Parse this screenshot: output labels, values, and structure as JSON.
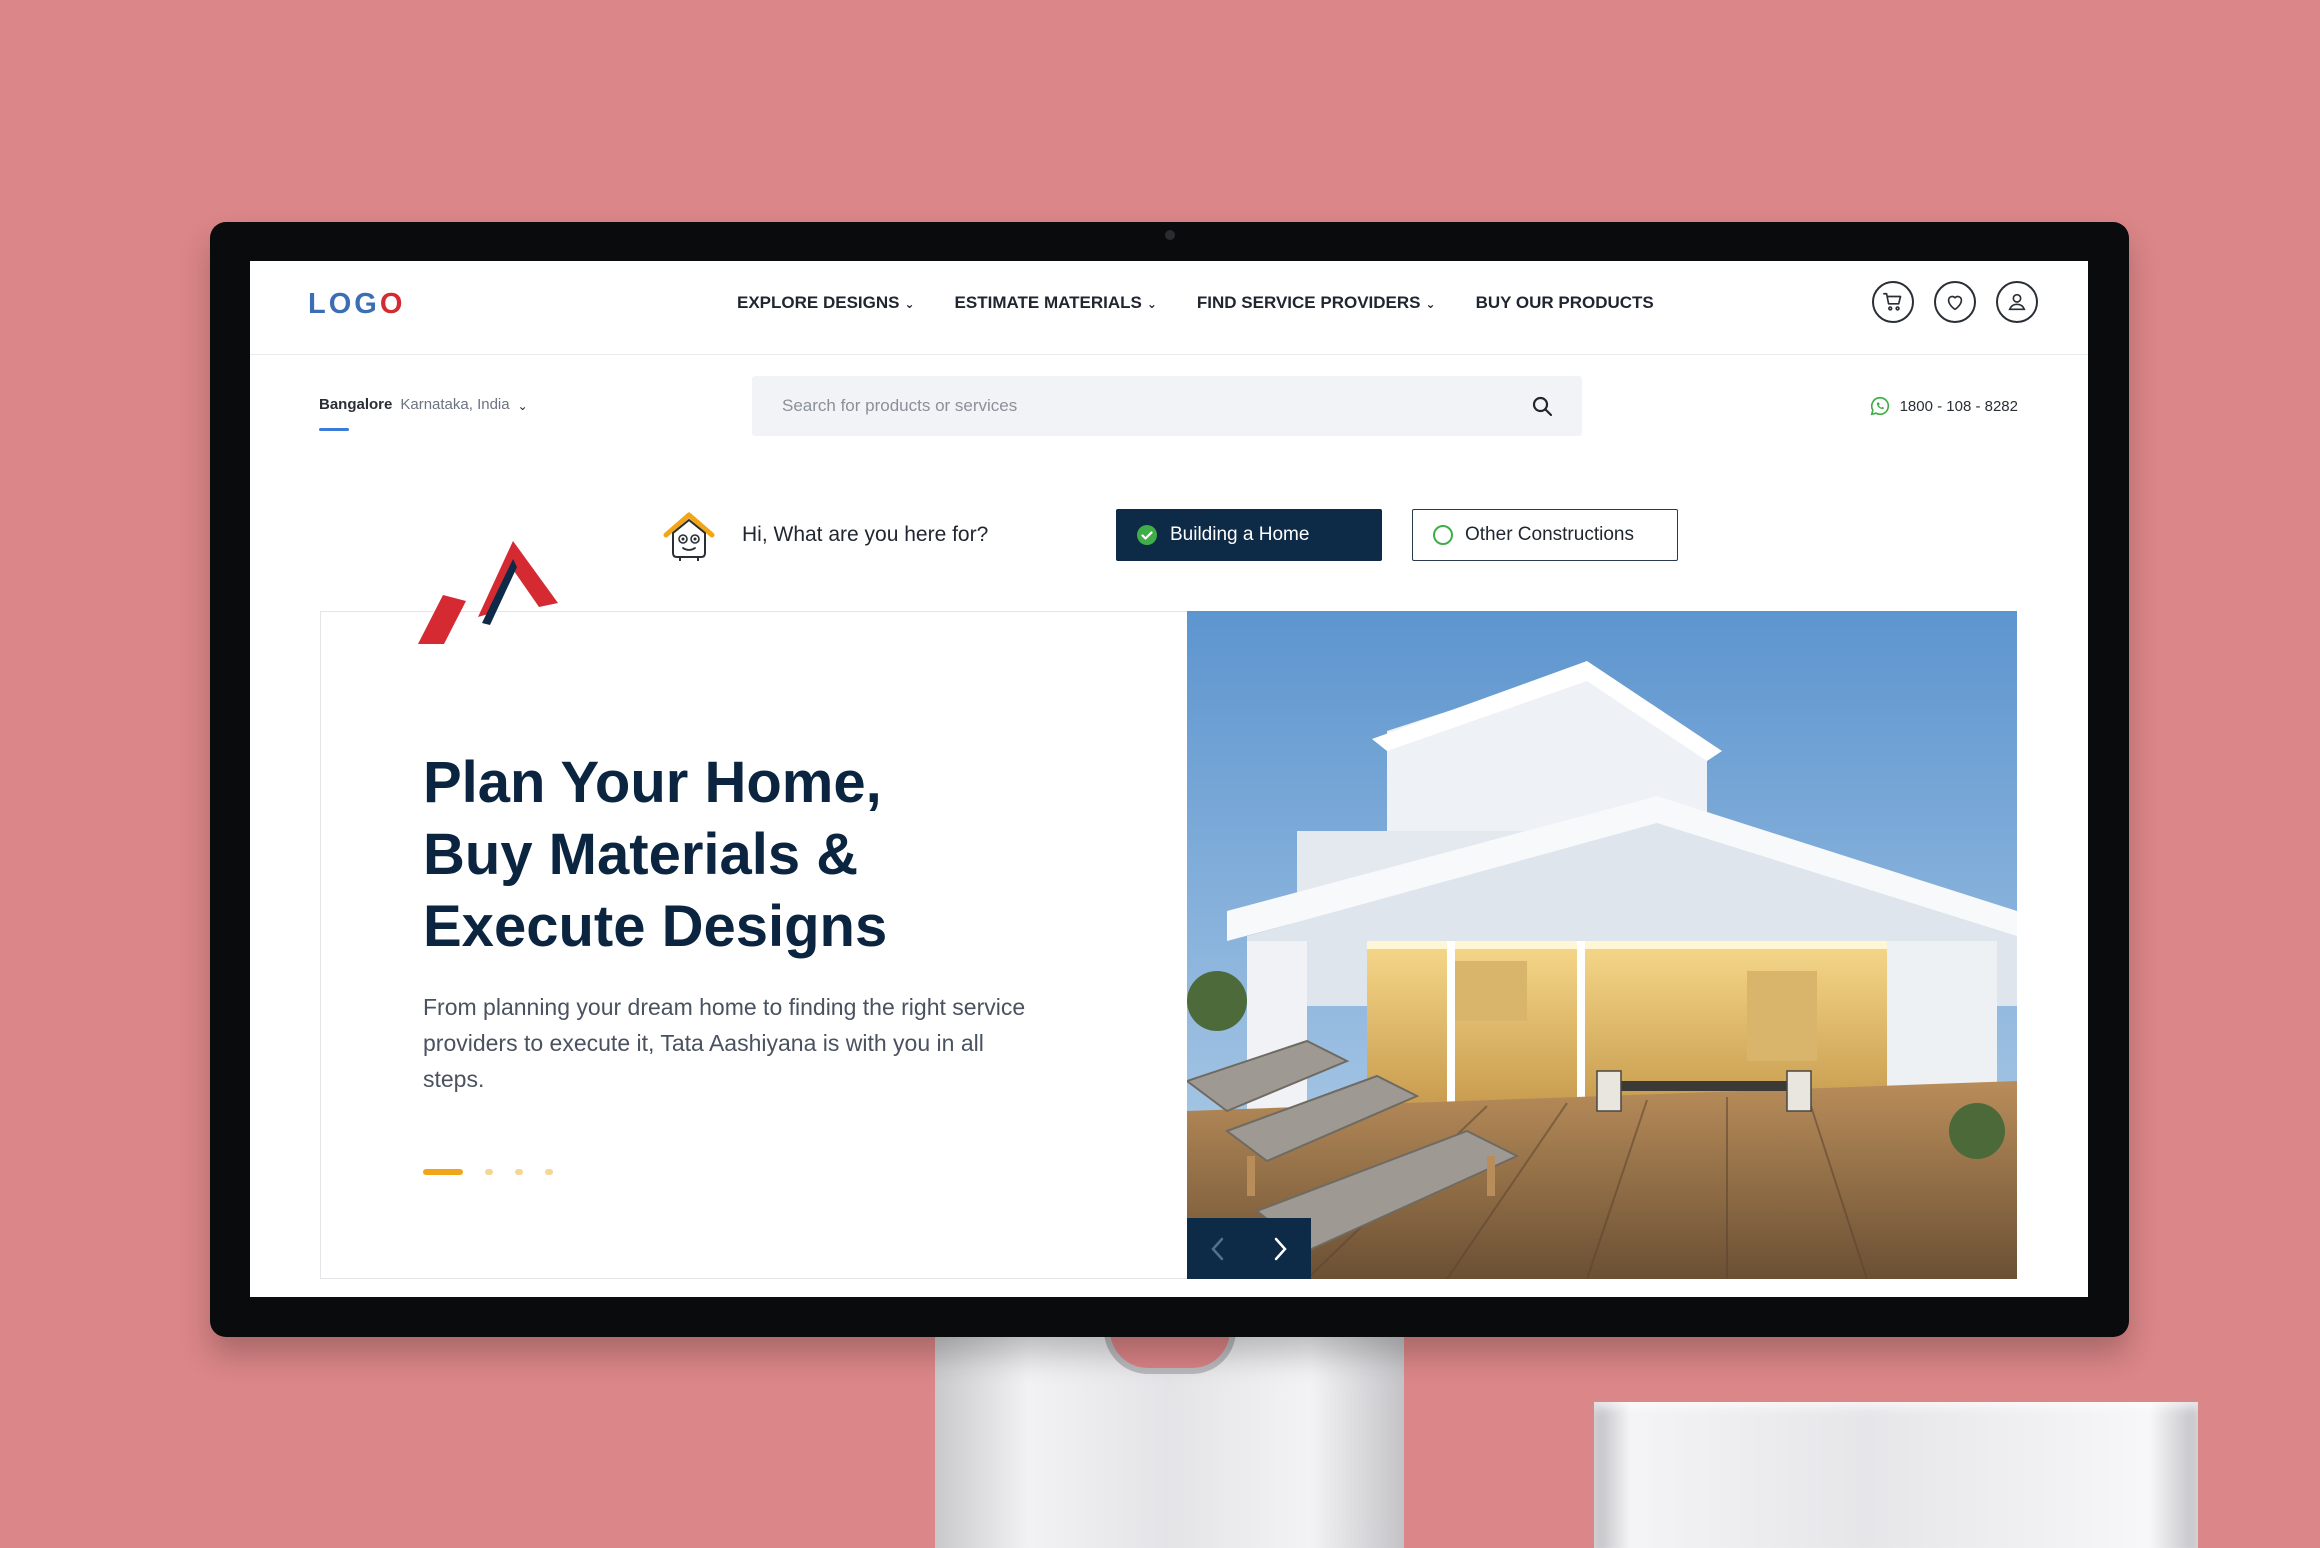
{
  "header": {
    "logo_prefix": "LOG",
    "logo_suffix": "O",
    "nav": [
      {
        "label": "EXPLORE DESIGNS",
        "has_dropdown": true
      },
      {
        "label": "ESTIMATE MATERIALS",
        "has_dropdown": true
      },
      {
        "label": "FIND SERVICE PROVIDERS",
        "has_dropdown": true
      },
      {
        "label": "BUY OUR PRODUCTS",
        "has_dropdown": false
      }
    ],
    "icons": [
      "cart-icon",
      "heart-icon",
      "user-icon"
    ]
  },
  "location": {
    "city": "Bangalore",
    "region": "Karnataka, India"
  },
  "search": {
    "placeholder": "Search for products or services",
    "value": ""
  },
  "contact": {
    "phone": "1800 - 108 - 8282"
  },
  "intent": {
    "question": "Hi, What are you here for?",
    "option_primary": "Building a Home",
    "option_secondary": "Other Constructions",
    "selected": "Building a Home"
  },
  "hero": {
    "title_lines": [
      "Plan Your Home,",
      "Buy Materials &",
      "Execute Designs"
    ],
    "subtitle": "From planning your dream home to finding the right service providers to execute it, Tata Aashiyana is with you in all steps.",
    "slide_index": 1,
    "slide_count": 4
  },
  "colors": {
    "background": "#db8688",
    "navy": "#0d2a47",
    "accent_red": "#d62a33",
    "logo_blue": "#3c6eb4",
    "slider_active": "#f2a516",
    "check_green": "#3fae49"
  }
}
